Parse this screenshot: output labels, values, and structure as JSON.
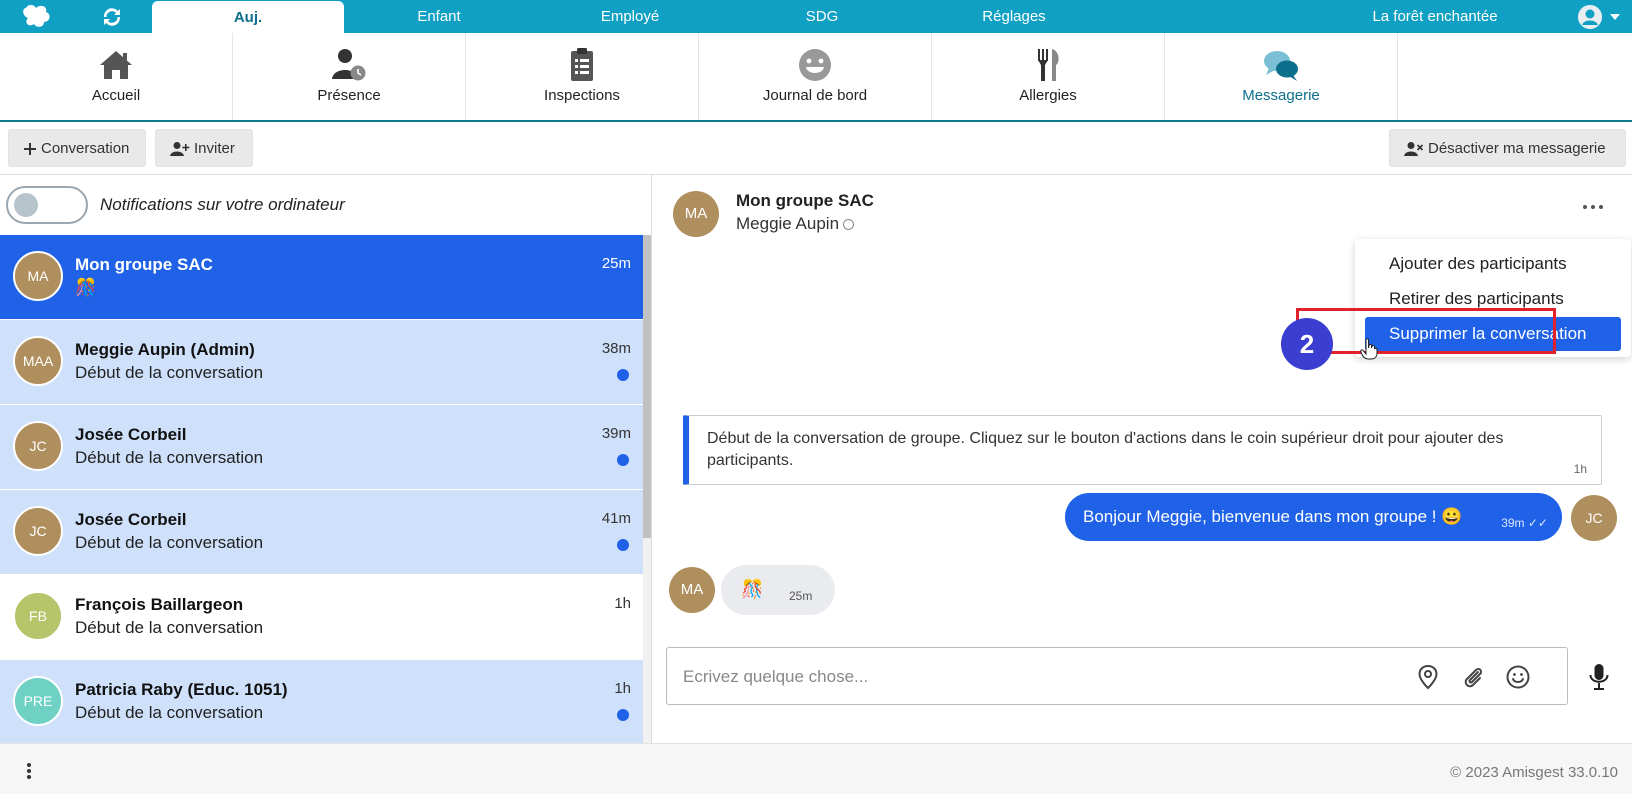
{
  "topnav": {
    "tabs": [
      {
        "label": "Auj."
      },
      {
        "label": "Enfant"
      },
      {
        "label": "Employé"
      },
      {
        "label": "SDG"
      },
      {
        "label": "Réglages"
      }
    ],
    "center_name": "La forêt enchantée"
  },
  "modules": [
    {
      "label": "Accueil",
      "icon": "home-icon"
    },
    {
      "label": "Présence",
      "icon": "person-clock-icon"
    },
    {
      "label": "Inspections",
      "icon": "clipboard-icon"
    },
    {
      "label": "Journal de bord",
      "icon": "smiley-icon"
    },
    {
      "label": "Allergies",
      "icon": "fork-knife-icon"
    },
    {
      "label": "Messagerie",
      "icon": "chat-bubbles-icon"
    }
  ],
  "toolbar": {
    "new_conversation": "Conversation",
    "invite": "Inviter",
    "disable_messaging": "Désactiver ma messagerie"
  },
  "notifications": {
    "label": "Notifications sur votre ordinateur"
  },
  "conversations": [
    {
      "avatar": "MA",
      "avatar_color": "#b08f5e",
      "name": "Mon groupe SAC",
      "preview": "🎊",
      "time": "25m"
    },
    {
      "avatar": "MAA",
      "avatar_color": "#b08f5e",
      "name": "Meggie Aupin (Admin)",
      "preview": "Début de la conversation",
      "time": "38m"
    },
    {
      "avatar": "JC",
      "avatar_color": "#b08f5e",
      "name": "Josée Corbeil",
      "preview": "Début de la conversation",
      "time": "39m"
    },
    {
      "avatar": "JC",
      "avatar_color": "#b08f5e",
      "name": "Josée Corbeil",
      "preview": "Début de la conversation",
      "time": "41m"
    },
    {
      "avatar": "FB",
      "avatar_color": "#b6c46a",
      "name": "François Baillargeon",
      "preview": "Début de la conversation",
      "time": "1h"
    },
    {
      "avatar": "PRE",
      "avatar_color": "#6fd0c4",
      "name": "Patricia Raby (Educ. 1051)",
      "preview": "Début de la conversation",
      "time": "1h"
    }
  ],
  "chat": {
    "avatar": "MA",
    "title": "Mon groupe SAC",
    "subtitle": "Meggie Aupin",
    "menu": {
      "items": [
        "Ajouter des participants",
        "Retirer des participants",
        "Supprimer la conversation"
      ]
    },
    "step_badge": "2",
    "system_message": {
      "text": "Début de la conversation de groupe. Cliquez sur le bouton d'actions dans le coin supérieur droit pour ajouter des participants.",
      "time": "1h"
    },
    "outgoing": {
      "text": "Bonjour Meggie, bienvenue dans mon groupe ! 😀",
      "time": "39m ✓✓",
      "avatar": "JC"
    },
    "incoming": {
      "avatar": "MA",
      "content": "🎊",
      "time": "25m"
    },
    "composer": {
      "placeholder": "Ecrivez quelque chose..."
    }
  },
  "footer": {
    "copyright": "© 2023 Amisgest 33.0.10"
  },
  "colors": {
    "topbar": "#0fa0c4",
    "accent": "#1f62e8",
    "highlight": "#e0202b",
    "badge": "#3b3fd1"
  }
}
